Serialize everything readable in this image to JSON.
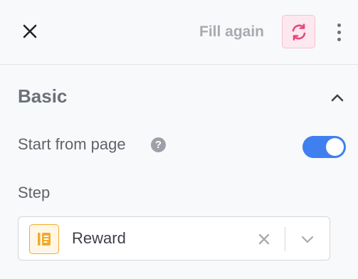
{
  "header": {
    "close_icon": "close-icon",
    "fill_again_label": "Fill again",
    "refresh_icon": "refresh-icon",
    "more_icon": "more-vertical-icon",
    "refresh_color": "#e8447e",
    "refresh_bg": "#fde8ef"
  },
  "basic": {
    "title": "Basic",
    "collapse_icon": "chevron-up-icon",
    "start_from_page": {
      "label": "Start from page",
      "help_glyph": "?",
      "enabled": true,
      "toggle_color": "#3f7ff0"
    },
    "step": {
      "label": "Step",
      "value": "Reward",
      "value_icon": "reward-icon",
      "value_icon_color": "#f0ab2a",
      "clear_icon": "clear-icon",
      "dropdown_icon": "chevron-down-icon"
    }
  }
}
